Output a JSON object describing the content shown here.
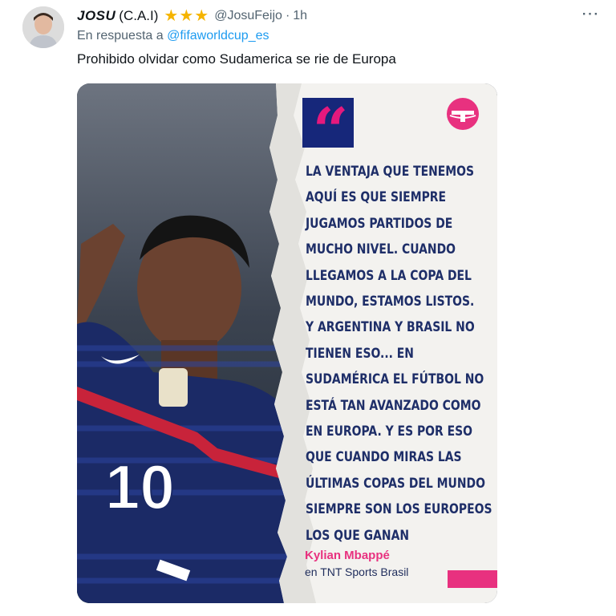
{
  "tweet": {
    "author": {
      "name": "JOSU",
      "name_suffix": "(C.A.I)",
      "stars": [
        "★",
        "★",
        "★"
      ],
      "handle": "@JosuFeijo",
      "separator": "·",
      "time": "1h"
    },
    "more_icon": "⋯",
    "reply": {
      "prefix": "En respuesta a",
      "target": "@fifaworldcup_es"
    },
    "text": "Prohibido olvidar como Sudamerica se rie de Europa",
    "media": {
      "quote_mark": "“",
      "quote_lines": [
        "LA VENTAJA QUE TENEMOS",
        "AQUÍ ES QUE SIEMPRE",
        "JUGAMOS PARTIDOS DE",
        "MUCHO NIVEL. CUANDO",
        "LLEGAMOS A LA COPA DEL",
        "MUNDO, ESTAMOS LISTOS.",
        "Y ARGENTINA Y BRASIL NO",
        "TIENEN ESO... EN",
        "SUDAMÉRICA EL FÚTBOL NO",
        "ESTÁ TAN AVANZADO COMO",
        "EN EUROPA. Y ES POR ESO",
        "QUE CUANDO MIRAS LAS",
        "ÚLTIMAS COPAS DEL MUNDO",
        "SIEMPRE SON LOS EUROPEOS",
        "LOS QUE GANAN"
      ],
      "speaker": "Kylian Mbappé",
      "source": "en TNT Sports Brasil",
      "jersey_number": "10"
    }
  },
  "colors": {
    "accent_link": "#1d9bf0",
    "muted": "#536471",
    "star": "#f5b400",
    "brand_pink": "#e8317f",
    "quote_navy": "#1e2e68"
  }
}
